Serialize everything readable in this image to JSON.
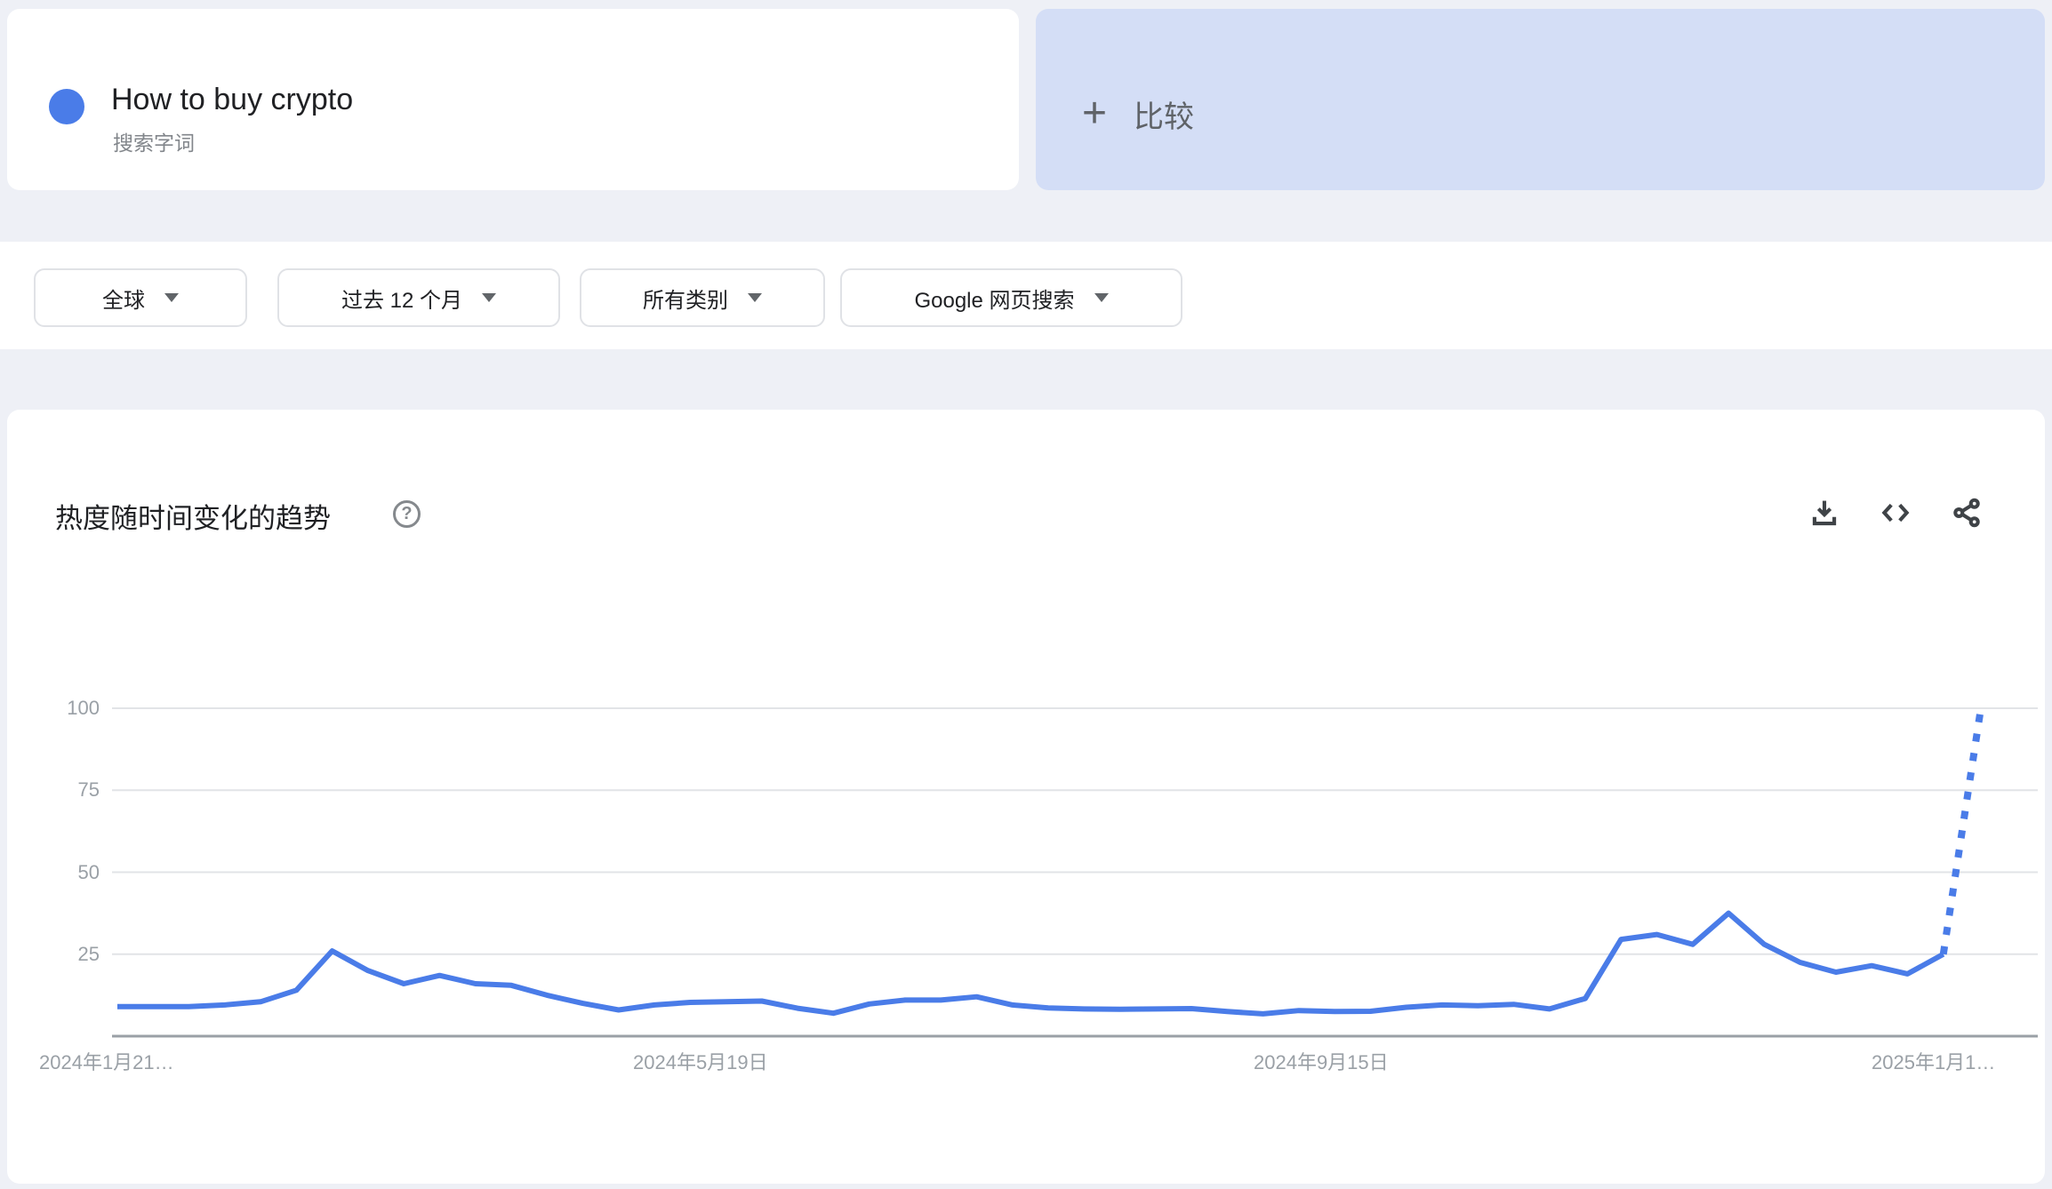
{
  "term_card": {
    "term": "How to buy crypto",
    "type_label": "搜索字词",
    "dot_color": "#4a7ce8"
  },
  "compare_card": {
    "plus": "+",
    "label": "比较"
  },
  "filters": [
    {
      "label": "全球"
    },
    {
      "label": "过去 12 个月"
    },
    {
      "label": "所有类别"
    },
    {
      "label": "Google 网页搜索"
    }
  ],
  "chart_card": {
    "title": "热度随时间变化的趋势",
    "help_glyph": "?",
    "action_icons": [
      "download-icon",
      "embed-code-icon",
      "share-icon"
    ]
  },
  "chart_data": {
    "type": "line",
    "title": "热度随时间变化的趋势",
    "series_name": "How to buy crypto",
    "line_color": "#4a7ce8",
    "grid": true,
    "legend_position": "none",
    "ylim": [
      0,
      100
    ],
    "y_ticks": [
      25,
      50,
      75,
      100
    ],
    "x_tick_labels": [
      "2024年1月21…",
      "2024年5月19日",
      "2024年9月15日",
      "2025年1月1…"
    ],
    "values": [
      9,
      9,
      9,
      9.5,
      10.5,
      14,
      26,
      20,
      16,
      18.5,
      16,
      15.5,
      12.5,
      10,
      8,
      9.5,
      10.3,
      10.5,
      10.7,
      8.5,
      7,
      9.8,
      11,
      11,
      12,
      9.5,
      8.6,
      8.3,
      8.2,
      8.3,
      8.4,
      7.5,
      6.8,
      7.8,
      7.5,
      7.6,
      8.8,
      9.5,
      9.3,
      9.7,
      8.3,
      11.5,
      29.5,
      31,
      28,
      37.5,
      28,
      22.5,
      19.5,
      21.5,
      19,
      25
    ],
    "partial_last_point": {
      "value": 100,
      "style": "dotted"
    },
    "axis_colors": {
      "gridline": "#e2e4e7",
      "baseline": "#9aa0a6",
      "tick_text": "#9aa0a6"
    }
  }
}
